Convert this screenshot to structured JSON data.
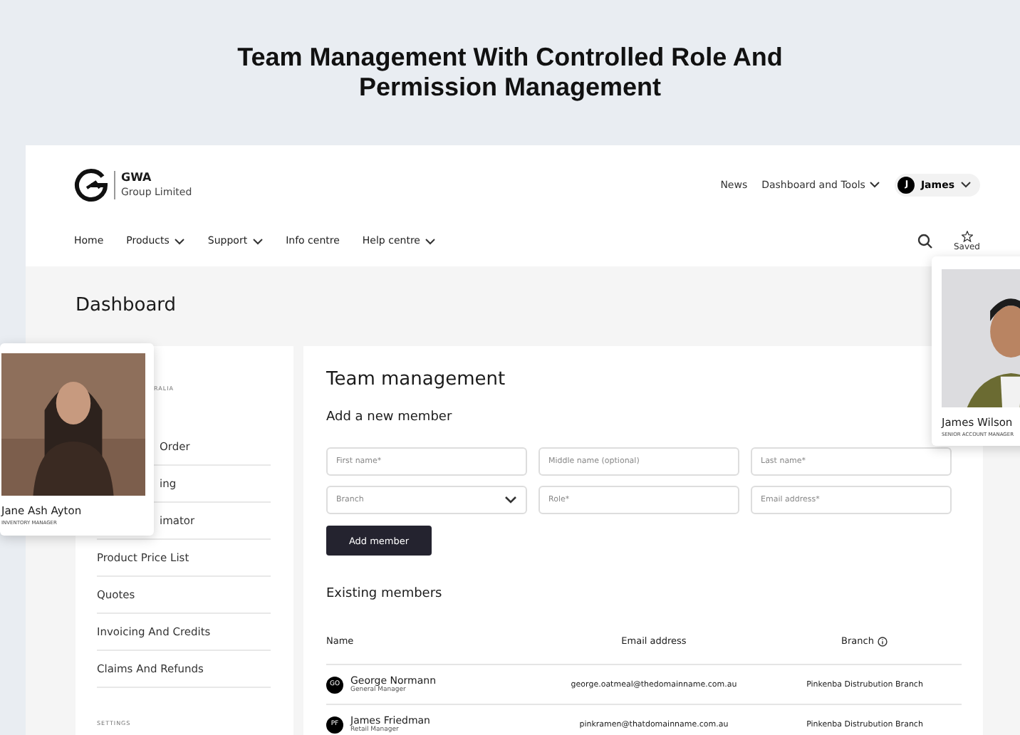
{
  "headline": "Team Management With Controlled Role And Permission Management",
  "logo": {
    "name": "GWA",
    "subtitle": "Group Limited"
  },
  "top_nav": [
    {
      "label": "News",
      "dropdown": false
    },
    {
      "label": "Dashboard and Tools",
      "dropdown": true
    }
  ],
  "user": {
    "initial": "J",
    "name": "James"
  },
  "main_nav": [
    {
      "label": "Home",
      "dropdown": false
    },
    {
      "label": "Products",
      "dropdown": true
    },
    {
      "label": "Support",
      "dropdown": true
    },
    {
      "label": "Info centre",
      "dropdown": false
    },
    {
      "label": "Help centre",
      "dropdown": true
    }
  ],
  "saved_label": "Saved",
  "page_title": "Dashboard",
  "sidebar": {
    "section_label": "RALIA",
    "covered_items": [
      "Order",
      "ing",
      "imator"
    ],
    "items": [
      "Product Price List",
      "Quotes",
      "Invoicing And Credits",
      "Claims And Refunds"
    ],
    "settings_label": "SETTINGS"
  },
  "team": {
    "title": "Team management",
    "add_title": "Add a new member",
    "fields": [
      {
        "placeholder": "First name*",
        "kind": "text"
      },
      {
        "placeholder": "Middle name (optional)",
        "kind": "text"
      },
      {
        "placeholder": "Last name*",
        "kind": "text"
      },
      {
        "placeholder": "Branch",
        "kind": "select"
      },
      {
        "placeholder": "Role*",
        "kind": "text"
      },
      {
        "placeholder": "Email address*",
        "kind": "text"
      }
    ],
    "add_button": "Add member",
    "existing_title": "Existing members",
    "columns": [
      {
        "label": "Name",
        "info": false
      },
      {
        "label": "Email address",
        "info": false
      },
      {
        "label": "Branch",
        "info": true
      }
    ],
    "rows": [
      {
        "initials": "GO",
        "name": "George Normann",
        "role": "General Manager",
        "email": "george.oatmeal@thedomainname.com.au",
        "branch": "Pinkenba Distrubution Branch"
      },
      {
        "initials": "PF",
        "name": "James Friedman",
        "role": "Retail Manager",
        "email": "pinkramen@thatdomainname.com.au",
        "branch": "Pinkenba Distrubution Branch"
      }
    ]
  },
  "profile_cards": [
    {
      "name": "Jane Ash Ayton",
      "role": "INVENTORY MANAGER",
      "kind": "left"
    },
    {
      "name": "James Wilson",
      "role": "SENIOR ACCOUNT MANAGER",
      "kind": "right"
    }
  ]
}
